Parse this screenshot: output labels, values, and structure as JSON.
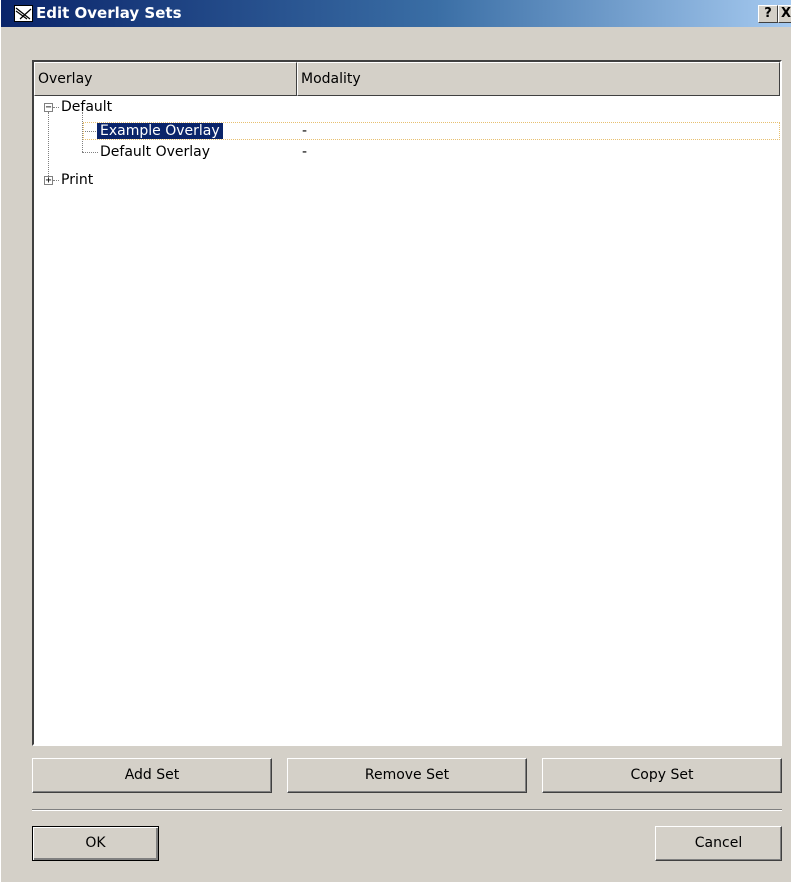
{
  "window": {
    "title": "Edit Overlay Sets",
    "help_button": "?",
    "close_button": "X"
  },
  "tree": {
    "columns": [
      "Overlay",
      "Modality"
    ],
    "groups": [
      {
        "label": "Default",
        "expanded": true,
        "expander": "−",
        "items": [
          {
            "label": "Example Overlay",
            "modality": "-",
            "selected": true
          },
          {
            "label": "Default Overlay",
            "modality": "-",
            "selected": false
          }
        ]
      },
      {
        "label": "Print",
        "expanded": false,
        "expander": "+"
      }
    ]
  },
  "buttons": {
    "add_set": "Add Set",
    "remove_set": "Remove Set",
    "copy_set": "Copy Set",
    "ok": "OK",
    "cancel": "Cancel"
  },
  "colors": {
    "title_gradient_start": "#0a246a",
    "selection": "#0a246a",
    "dialog_face": "#d4d0c8"
  }
}
